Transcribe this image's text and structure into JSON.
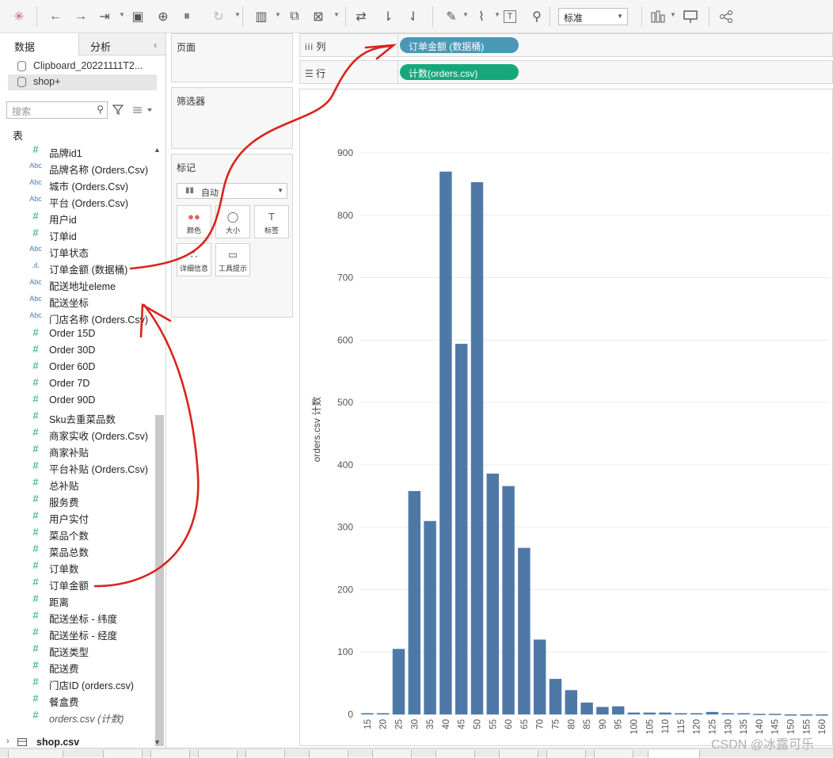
{
  "toolbar": {
    "buttons": [
      {
        "icon": "tableau-logo-icon"
      },
      {
        "icon": "undo-icon"
      },
      {
        "icon": "redo-icon"
      },
      {
        "icon": "replay-icon"
      },
      {
        "icon": "save-icon"
      },
      {
        "icon": "new-datasource-icon"
      },
      {
        "icon": "pause-updates-icon"
      },
      {
        "icon": "refresh-icon"
      },
      {
        "icon": "new-worksheet-icon"
      },
      {
        "icon": "duplicate-icon"
      },
      {
        "icon": "clear-sheet-icon"
      },
      {
        "icon": "swap-icon"
      },
      {
        "icon": "sort-ascending-icon"
      },
      {
        "icon": "sort-descending-icon"
      },
      {
        "icon": "highlight-icon"
      },
      {
        "icon": "group-icon"
      },
      {
        "icon": "show-labels-icon"
      },
      {
        "icon": "pin-icon"
      }
    ],
    "fit_value": "标准",
    "right_icons": [
      "show-me-icon",
      "presentation-icon",
      "share-icon"
    ]
  },
  "left_panel": {
    "tabs": [
      "数据",
      "分析"
    ],
    "datasources": [
      "Clipboard_20221111T2...",
      "shop+"
    ],
    "search_placeholder": "搜索",
    "section_label": "表",
    "fields": [
      {
        "type": "num",
        "label": "品牌id1"
      },
      {
        "type": "abc",
        "label": "品牌名称 (Orders.Csv)"
      },
      {
        "type": "abc",
        "label": "城市 (Orders.Csv)"
      },
      {
        "type": "abc",
        "label": "平台 (Orders.Csv)"
      },
      {
        "type": "num",
        "label": "用户id"
      },
      {
        "type": "num",
        "label": "订单id"
      },
      {
        "type": "abc",
        "label": "订单状态"
      },
      {
        "type": "bin",
        "label": "订单金额 (数据桶)"
      },
      {
        "type": "abc",
        "label": "配送地址eleme"
      },
      {
        "type": "abc",
        "label": "配送坐标"
      },
      {
        "type": "abc",
        "label": "门店名称 (Orders.Csv)"
      },
      {
        "type": "num",
        "label": "Order 15D"
      },
      {
        "type": "num",
        "label": "Order 30D"
      },
      {
        "type": "num",
        "label": "Order 60D"
      },
      {
        "type": "num",
        "label": "Order 7D"
      },
      {
        "type": "num",
        "label": "Order 90D"
      },
      {
        "type": "num",
        "label": "Sku去重菜品数"
      },
      {
        "type": "num",
        "label": "商家实收 (Orders.Csv)"
      },
      {
        "type": "num",
        "label": "商家补贴"
      },
      {
        "type": "num",
        "label": "平台补贴 (Orders.Csv)"
      },
      {
        "type": "num",
        "label": "总补贴"
      },
      {
        "type": "num",
        "label": "服务费"
      },
      {
        "type": "num",
        "label": "用户实付"
      },
      {
        "type": "num",
        "label": "菜品个数"
      },
      {
        "type": "num",
        "label": "菜品总数"
      },
      {
        "type": "num",
        "label": "订单数"
      },
      {
        "type": "num",
        "label": "订单金额"
      },
      {
        "type": "num",
        "label": "距离"
      },
      {
        "type": "num",
        "label": "配送坐标 - 纬度"
      },
      {
        "type": "num",
        "label": "配送坐标 - 经度"
      },
      {
        "type": "num",
        "label": "配送类型"
      },
      {
        "type": "num",
        "label": "配送费"
      },
      {
        "type": "num",
        "label": "门店ID (orders.csv)"
      },
      {
        "type": "num",
        "label": "餐盒费"
      },
      {
        "type": "numi",
        "label": "orders.csv (计数)"
      }
    ],
    "next_table": "shop.csv"
  },
  "cards": {
    "pages": "页面",
    "filters": "筛选器",
    "marks": "标记",
    "mark_type": "自动",
    "buttons": [
      {
        "icon": "color-icon",
        "label": "颜色"
      },
      {
        "icon": "size-icon",
        "label": "大小"
      },
      {
        "icon": "label-icon",
        "label": "标签"
      },
      {
        "icon": "detail-icon",
        "label": "详细信息"
      },
      {
        "icon": "tooltip-icon",
        "label": "工具提示"
      }
    ]
  },
  "shelves": {
    "columns_label": "列",
    "rows_label": "行",
    "columns_pill": "订单金额 (数据桶)",
    "rows_pill": "计数(orders.csv)",
    "columns_pill_color": "#4a98b5",
    "rows_pill_color": "#17a87a"
  },
  "colors": {
    "bar": "#4e79a7",
    "annotation": "#d9231b"
  },
  "watermark": "CSDN @冰露可乐",
  "chart_data": {
    "type": "bar",
    "ylabel": "orders.csv 计数",
    "ylim": [
      0,
      900
    ],
    "yticks": [
      0,
      100,
      200,
      300,
      400,
      500,
      600,
      700,
      800,
      900
    ],
    "categories": [
      "15",
      "20",
      "25",
      "30",
      "35",
      "40",
      "45",
      "50",
      "55",
      "60",
      "65",
      "70",
      "75",
      "80",
      "85",
      "90",
      "95",
      "100",
      "105",
      "110",
      "115",
      "120",
      "125",
      "130",
      "135",
      "140",
      "145",
      "150",
      "155",
      "160"
    ],
    "values": [
      2,
      2,
      105,
      358,
      310,
      870,
      594,
      853,
      386,
      366,
      267,
      120,
      57,
      39,
      19,
      12,
      13,
      3,
      3,
      3,
      2,
      2,
      4,
      2,
      2,
      1,
      1,
      0,
      0,
      0
    ],
    "grid": true
  }
}
